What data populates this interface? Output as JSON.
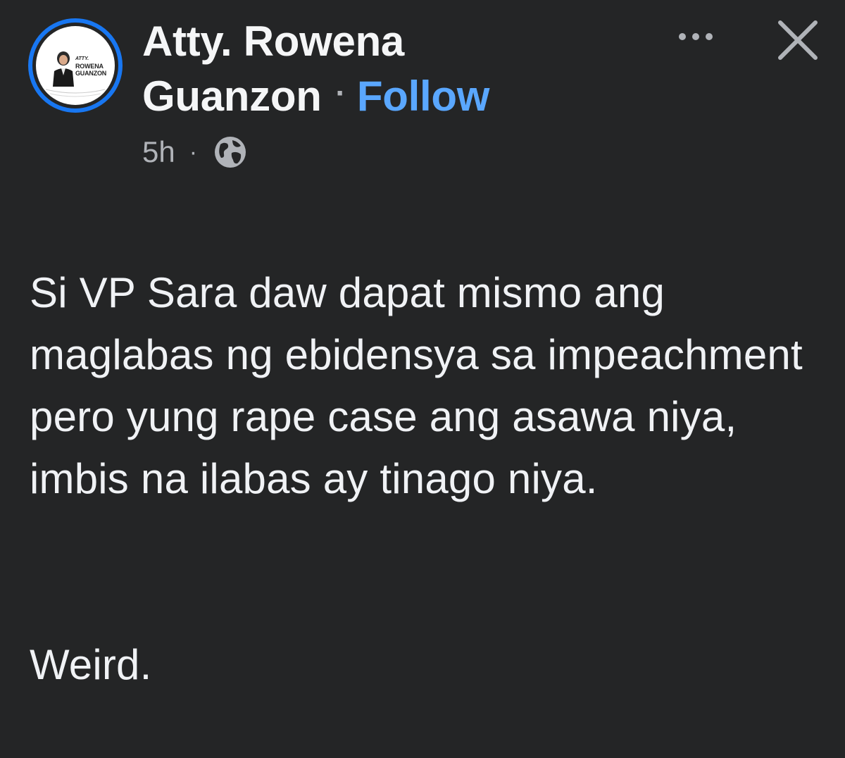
{
  "post": {
    "author": {
      "name_line1": "Atty. Rowena",
      "name_line2": "Guanzon",
      "avatar_logo": {
        "prefix": "ATTY.",
        "line1": "ROWENA",
        "line2": "GUANZON"
      }
    },
    "separator": "·",
    "follow_label": "Follow",
    "timestamp": "5h",
    "meta_separator": "·",
    "privacy_icon": "globe-icon",
    "more_icon": "more-options-icon",
    "close_icon": "close-icon",
    "body": "Si VP Sara daw dapat mismo ang maglabas ng ebidensya sa impeachment pero yung rape case ang asawa niya, imbis na ilabas ay tinago niya.",
    "closing": "Weird."
  },
  "colors": {
    "background": "#242526",
    "accent": "#1877f2",
    "follow": "#5aa7ff",
    "secondary_text": "#b0b3b8",
    "primary_text": "#f0f2f5"
  }
}
